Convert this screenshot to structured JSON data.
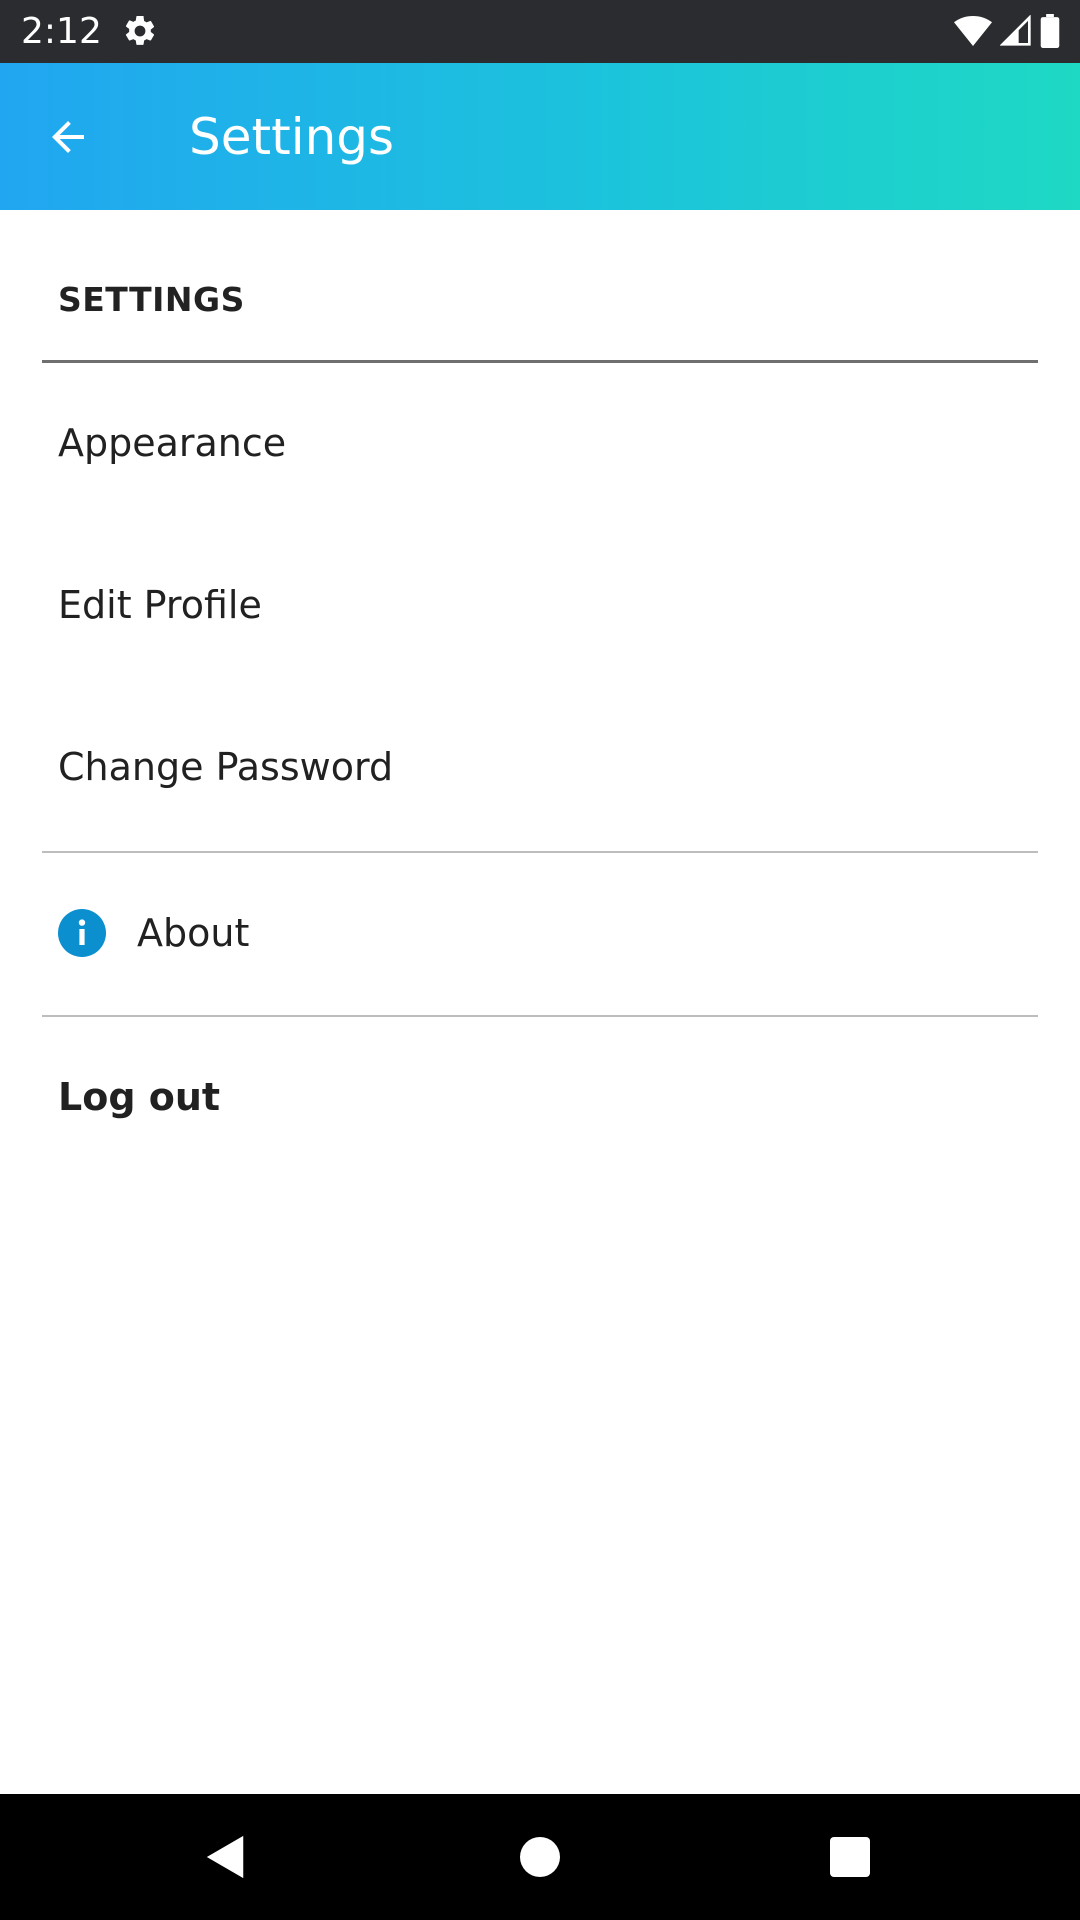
{
  "status_bar": {
    "time": "2:12",
    "icons": [
      "settings-gear-icon",
      "wifi-icon",
      "cellular-signal-icon",
      "battery-icon"
    ]
  },
  "app_bar": {
    "title": "Settings",
    "back_icon": "arrow-back-icon",
    "gradient": [
      "#21a6f1",
      "#1cc3dc",
      "#1ed9c4"
    ]
  },
  "settings": {
    "section_header": "SETTINGS",
    "items": [
      {
        "label": "Appearance"
      },
      {
        "label": "Edit Profile"
      },
      {
        "label": "Change Password"
      }
    ],
    "about": {
      "label": "About",
      "icon": "info-icon",
      "icon_color": "#0b8fcf"
    },
    "logout": {
      "label": "Log out"
    }
  },
  "nav_bar": {
    "buttons": [
      "back-triangle-icon",
      "home-circle-icon",
      "recents-square-icon"
    ]
  }
}
